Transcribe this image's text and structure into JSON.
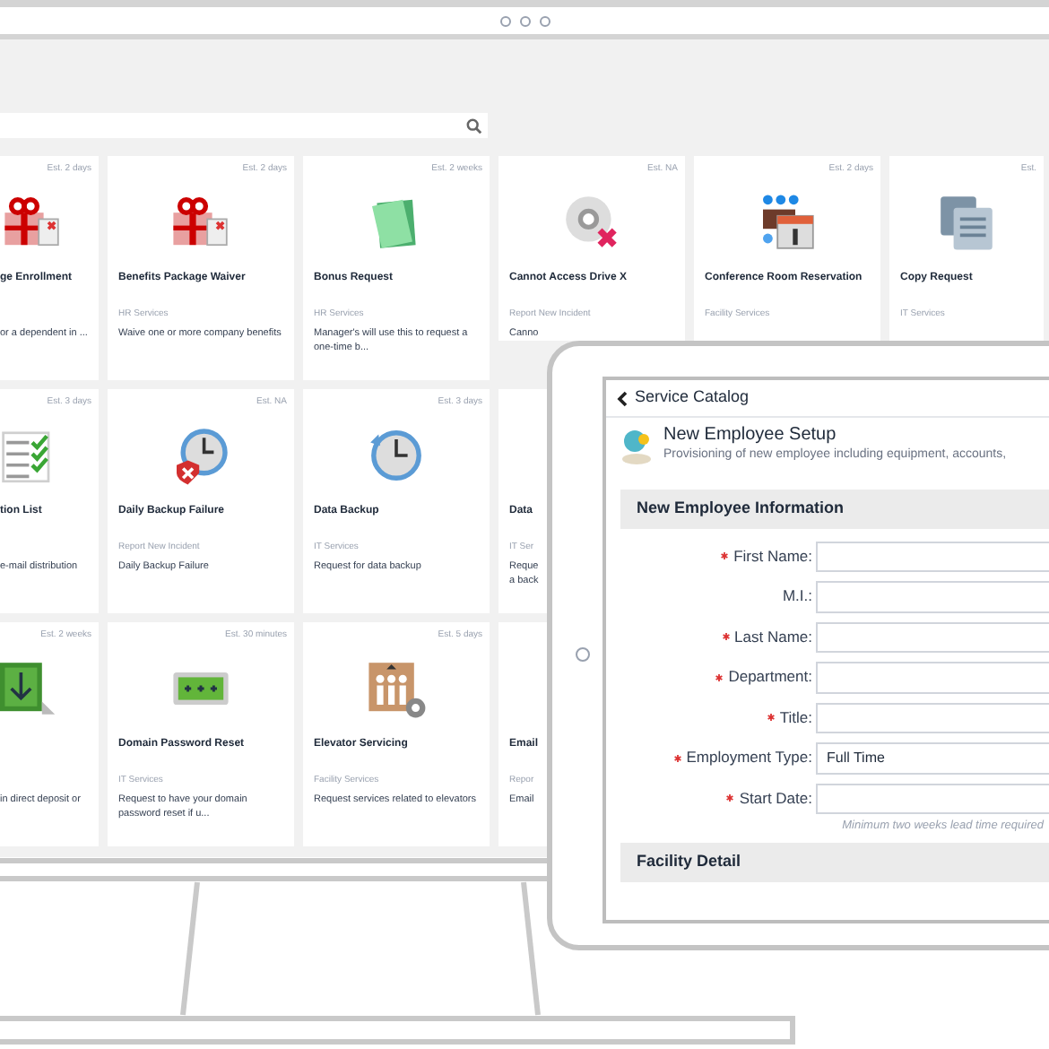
{
  "monitor": {
    "card_rows": [
      [
        {
          "est": "Est. 2 days",
          "title": "ge Enrollment",
          "description": "or a dependent in ..."
        },
        {
          "est": "Est. 2 days",
          "title": "Benefits Package Waiver",
          "category": "HR Services",
          "description": "Waive one or more company benefits"
        },
        {
          "est": "Est. 2 weeks",
          "title": "Bonus Request",
          "category": "HR Services",
          "description": "Manager's will use this to request a one-time b..."
        },
        {
          "est": "Est. NA",
          "title": "Cannot Access Drive X",
          "category": "Report New Incident",
          "description": "Canno"
        },
        {
          "est": "Est. 2 days",
          "title": "Conference Room Reservation",
          "category": "Facility Services"
        },
        {
          "est": "Est.",
          "title": "Copy Request",
          "category": "IT Services"
        }
      ],
      [
        {
          "est": "Est. 3 days",
          "title": "tion List",
          "description": "e-mail distribution"
        },
        {
          "est": "Est. NA",
          "title": "Daily Backup Failure",
          "category": "Report New Incident",
          "description": "Daily Backup Failure"
        },
        {
          "est": "Est. 3 days",
          "title": "Data Backup",
          "category": "IT Services",
          "description": "Request for data backup"
        },
        {
          "title": "Data",
          "category": "IT Ser",
          "description": "Reque a back"
        }
      ],
      [
        {
          "est": "Est. 2 weeks",
          "description": "in direct deposit or"
        },
        {
          "est": "Est. 30 minutes",
          "title": "Domain Password Reset",
          "category": "IT Services",
          "description": "Request to have your domain password reset if u..."
        },
        {
          "est": "Est. 5 days",
          "title": "Elevator Servicing",
          "category": "Facility Services",
          "description": "Request services related to elevators"
        },
        {
          "title": "Email",
          "category": "Repor",
          "description": "Email"
        }
      ]
    ]
  },
  "tablet": {
    "back_link": "Service Catalog",
    "header": {
      "title": "New Employee Setup",
      "subtitle": "Provisioning of new employee including equipment, accounts,"
    },
    "sections": [
      {
        "title": "New Employee Information",
        "fields": [
          {
            "label": "First Name:",
            "required": true
          },
          {
            "label": "M.I.:",
            "required": false
          },
          {
            "label": "Last Name:",
            "required": true
          },
          {
            "label": "Department:",
            "required": true
          },
          {
            "label": "Title:",
            "required": true
          },
          {
            "label": "Employment Type:",
            "required": true,
            "value": "Full Time"
          },
          {
            "label": "Start Date:",
            "required": true
          }
        ],
        "hint": "Minimum two weeks lead time required"
      },
      {
        "title": "Facility Detail"
      }
    ]
  }
}
